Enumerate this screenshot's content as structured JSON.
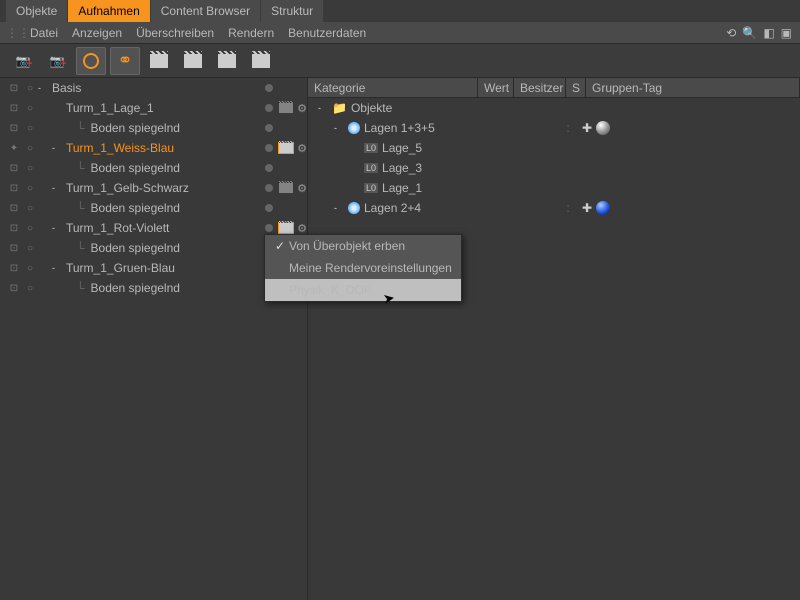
{
  "tabs": [
    "Objekte",
    "Aufnahmen",
    "Content Browser",
    "Struktur"
  ],
  "active_tab": 1,
  "menu": [
    "Datei",
    "Anzeigen",
    "Überschreiben",
    "Rendern",
    "Benutzerdaten"
  ],
  "left_tree": [
    {
      "label": "Basis",
      "depth": 0,
      "toggle": "-",
      "active": false,
      "clap": "",
      "gear": false,
      "sel": false
    },
    {
      "label": "Turm_1_Lage_1",
      "depth": 1,
      "toggle": "",
      "active": false,
      "clap": "dim",
      "gear": true,
      "sel": false
    },
    {
      "label": "Boden spiegelnd",
      "depth": 2,
      "toggle": "",
      "active": false,
      "clap": "",
      "gear": false,
      "sel": false,
      "elbow": true
    },
    {
      "label": "Turm_1_Weiss-Blau",
      "depth": 1,
      "toggle": "-",
      "active": true,
      "clap": "orange",
      "gear": true,
      "sel": true
    },
    {
      "label": "Boden spiegelnd",
      "depth": 2,
      "toggle": "",
      "active": false,
      "clap": "",
      "gear": false,
      "sel": false,
      "elbow": true
    },
    {
      "label": "Turm_1_Gelb-Schwarz",
      "depth": 1,
      "toggle": "-",
      "active": false,
      "clap": "dim",
      "gear": true,
      "sel": false
    },
    {
      "label": "Boden spiegelnd",
      "depth": 2,
      "toggle": "",
      "active": false,
      "clap": "",
      "gear": false,
      "sel": false,
      "elbow": true
    },
    {
      "label": "Turm_1_Rot-Violett",
      "depth": 1,
      "toggle": "-",
      "active": false,
      "clap": "orange",
      "gear": true,
      "sel": false
    },
    {
      "label": "Boden spiegelnd",
      "depth": 2,
      "toggle": "",
      "active": false,
      "clap": "",
      "gear": false,
      "sel": false,
      "elbow": true
    },
    {
      "label": "Turm_1_Gruen-Blau",
      "depth": 1,
      "toggle": "-",
      "active": false,
      "clap": "dim",
      "gear": true,
      "sel": false
    },
    {
      "label": "Boden spiegelnd",
      "depth": 2,
      "toggle": "",
      "active": false,
      "clap": "",
      "gear": false,
      "sel": false,
      "elbow": true
    }
  ],
  "right_headers": {
    "kat": "Kategorie",
    "wert": "Wert",
    "bes": "Besitzer",
    "s": "S",
    "tag": "Gruppen-Tag"
  },
  "right_tree": [
    {
      "label": "Objekte",
      "icon": "folder",
      "depth": 0,
      "toggle": "-",
      "s": "",
      "tag": ""
    },
    {
      "label": "Lagen 1+3+5",
      "icon": "render",
      "depth": 1,
      "toggle": "-",
      "s": ":",
      "tag": "grey"
    },
    {
      "label": "Lage_5",
      "icon": "lo",
      "depth": 2,
      "toggle": "",
      "s": "",
      "tag": ""
    },
    {
      "label": "Lage_3",
      "icon": "lo",
      "depth": 2,
      "toggle": "",
      "s": "",
      "tag": ""
    },
    {
      "label": "Lage_1",
      "icon": "lo",
      "depth": 2,
      "toggle": "",
      "s": "",
      "tag": ""
    },
    {
      "label": "Lagen 2+4",
      "icon": "render",
      "depth": 1,
      "toggle": "-",
      "s": ":",
      "tag": "blue"
    }
  ],
  "context_menu": [
    {
      "label": "Von Überobjekt erben",
      "checked": true,
      "hover": false
    },
    {
      "label": "Meine Rendervoreinstellungen",
      "checked": false,
      "hover": false
    },
    {
      "label": "Physik_K_DOF",
      "checked": false,
      "hover": true
    }
  ]
}
